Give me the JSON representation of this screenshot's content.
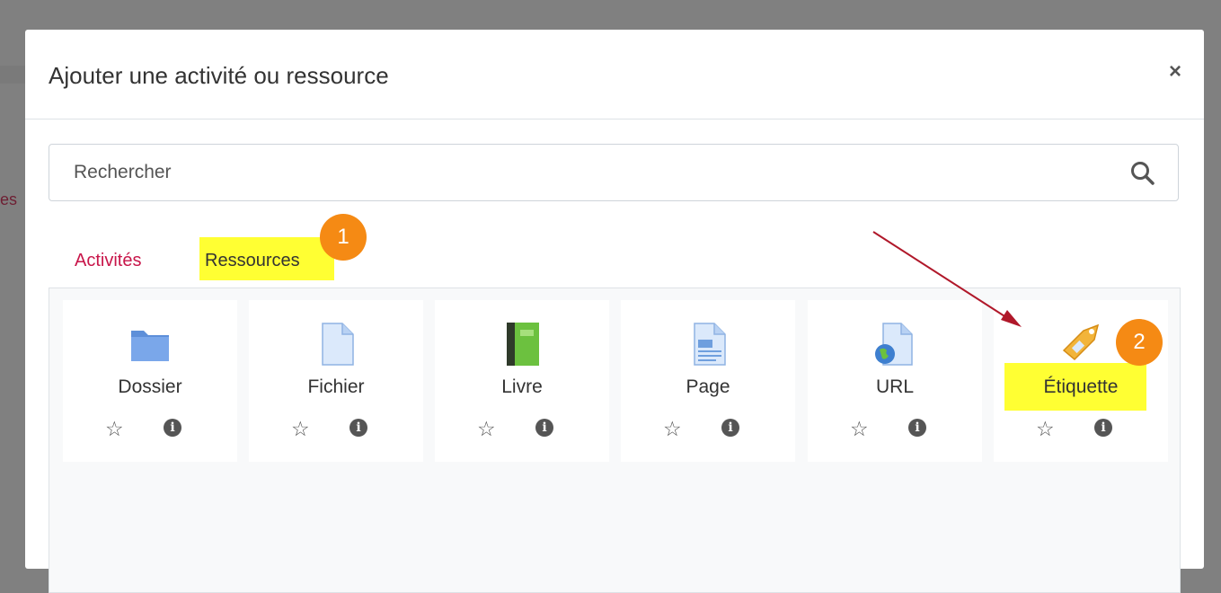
{
  "backdrop": {
    "text": "es"
  },
  "modal": {
    "title": "Ajouter une activité ou ressource",
    "close_symbol": "×"
  },
  "search": {
    "placeholder": "Rechercher",
    "icon": "search-icon"
  },
  "tabs": [
    {
      "label": "Activités",
      "active": false
    },
    {
      "label": "Ressources",
      "active": true
    }
  ],
  "annotations": [
    {
      "number": "1",
      "color": "#f58a14"
    },
    {
      "number": "2",
      "color": "#f58a14"
    }
  ],
  "highlight_color": "#ffff33",
  "cards": [
    {
      "label": "Dossier",
      "icon": "folder-icon"
    },
    {
      "label": "Fichier",
      "icon": "file-icon"
    },
    {
      "label": "Livre",
      "icon": "book-icon"
    },
    {
      "label": "Page",
      "icon": "page-icon"
    },
    {
      "label": "URL",
      "icon": "url-icon"
    },
    {
      "label": "Étiquette",
      "icon": "label-tag-icon"
    }
  ],
  "card_actions": {
    "favourite_icon": "star-icon",
    "info_icon": "info-icon"
  },
  "colors": {
    "accent": "#c8164a",
    "arrow": "#b0182a"
  }
}
